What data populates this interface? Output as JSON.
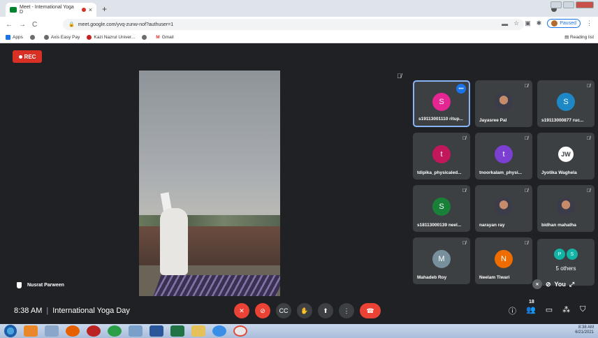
{
  "browser": {
    "tab_title": "Meet - International Yoga D",
    "tab_close": "×",
    "new_tab": "+",
    "url": "meet.google.com/yvq-zunw-nof?authuser=1",
    "nav_back": "←",
    "nav_forward": "→",
    "nav_reload": "C",
    "profile_status": "Paused",
    "menu": "⋮",
    "bookmarks": [
      {
        "label": "Apps",
        "color": "#1a73e8"
      },
      {
        "label": "",
        "color": "#6b6b6b"
      },
      {
        "label": "Axis Easy Pay",
        "color": "#6b6b6b"
      },
      {
        "label": "Kazi Nazrul Univer...",
        "color": "#c5221f"
      },
      {
        "label": "",
        "color": "#6b6b6b"
      },
      {
        "label": "Gmail",
        "color": "#d93025"
      }
    ],
    "reading_list": "Reading list"
  },
  "meeting": {
    "rec_label": "REC",
    "time": "8:38 AM",
    "separator": "|",
    "title": "International Yoga Day",
    "presenter_name": "Nusrat Parween",
    "self_label": "You",
    "people_count": "18"
  },
  "participants": [
    {
      "name": "s19113001110 ritup...",
      "initial": "S",
      "color": "#e52592",
      "active": true
    },
    {
      "name": "Jayasree Pal",
      "initial": "",
      "color": "photo",
      "active": false
    },
    {
      "name": "s19113000877 ruc...",
      "initial": "S",
      "color": "#1e88c7",
      "active": false
    },
    {
      "name": "tdipika_physicaled...",
      "initial": "t",
      "color": "#c2185b",
      "active": false
    },
    {
      "name": "tnoorkalam_physi...",
      "initial": "t",
      "color": "#7b3fd1",
      "active": false
    },
    {
      "name": "Jyotika Waghela",
      "initial": "JW",
      "color": "jw",
      "active": false
    },
    {
      "name": "s18113000139 neel...",
      "initial": "S",
      "color": "#188038",
      "active": false
    },
    {
      "name": "narayan ray",
      "initial": "",
      "color": "photo",
      "active": false
    },
    {
      "name": "bidhan mahatha",
      "initial": "",
      "color": "photo",
      "active": false
    },
    {
      "name": "Mahadeb Roy",
      "initial": "M",
      "color": "#78909c",
      "active": false
    },
    {
      "name": "Neelam Tiwari",
      "initial": "N",
      "color": "#ef6c00",
      "active": false
    }
  ],
  "others": {
    "label": "5 others",
    "avatars": [
      {
        "initial": "P",
        "color": "#12b5a5"
      },
      {
        "initial": "S",
        "color": "#12b5a5"
      }
    ]
  },
  "icons": {
    "mic_off": "🎙",
    "more": "•••"
  },
  "taskbar": {
    "clock": "8:38 AM",
    "date": "6/21/2021"
  }
}
